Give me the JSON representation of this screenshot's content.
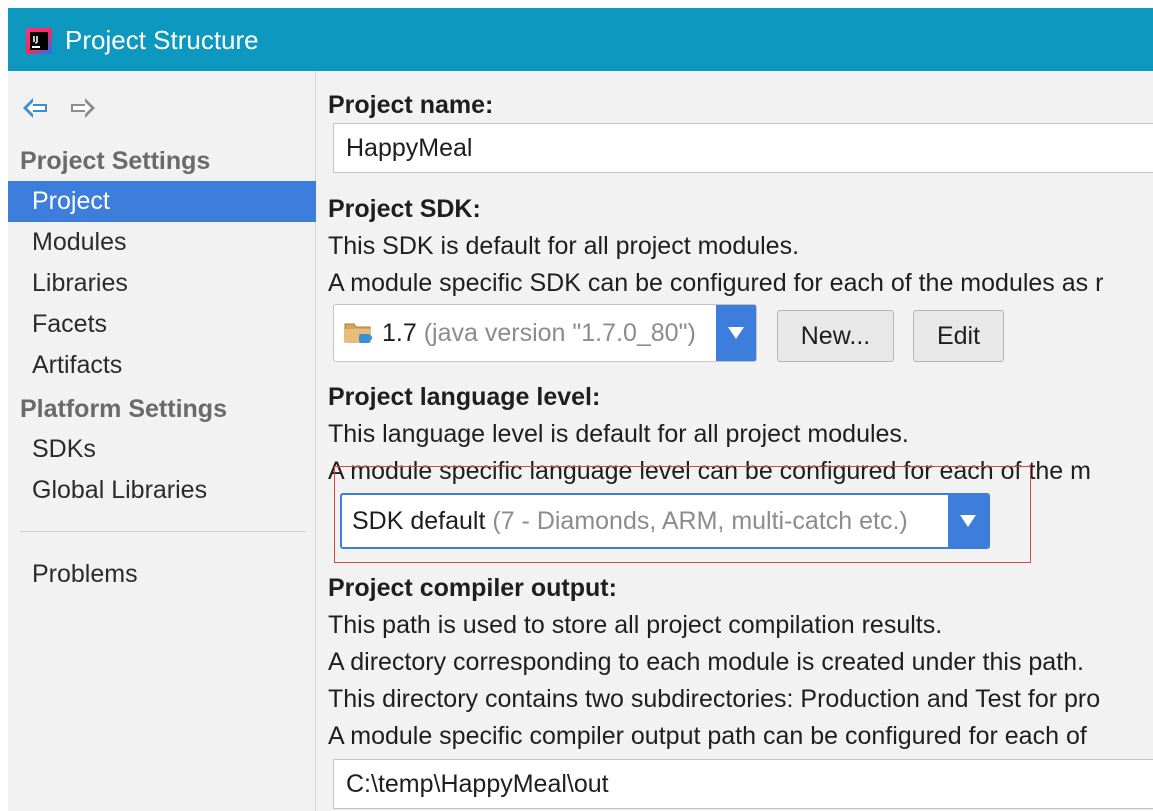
{
  "window": {
    "title": "Project Structure",
    "icon": "intellij-icon",
    "colors": {
      "titlebar": "#0d99bf",
      "accent": "#3d7ddb",
      "highlight": "#d94545"
    }
  },
  "sidebar": {
    "nav_icons": [
      "back-arrow-icon",
      "forward-arrow-icon"
    ],
    "project_settings_header": "Project Settings",
    "project_settings_items": [
      {
        "label": "Project",
        "selected": true
      },
      {
        "label": "Modules"
      },
      {
        "label": "Libraries"
      },
      {
        "label": "Facets"
      },
      {
        "label": "Artifacts"
      }
    ],
    "platform_settings_header": "Platform Settings",
    "platform_settings_items": [
      {
        "label": "SDKs"
      },
      {
        "label": "Global Libraries"
      }
    ],
    "problems_label": "Problems"
  },
  "main": {
    "project_name": {
      "label": "Project name:",
      "value": "HappyMeal"
    },
    "project_sdk": {
      "label": "Project SDK:",
      "desc1": "This SDK is default for all project modules.",
      "desc2": "A module specific SDK can be configured for each of the modules as r",
      "selected_version": "1.7",
      "selected_detail": "(java version \"1.7.0_80\")",
      "icon": "folder-java-icon",
      "new_button": "New...",
      "edit_button": "Edit"
    },
    "language_level": {
      "label": "Project language level:",
      "desc1": "This language level is default for all project modules.",
      "desc2": "A module specific language level can be configured for each of the m",
      "selected_value": "SDK default",
      "selected_detail": "(7 - Diamonds, ARM, multi-catch etc.)"
    },
    "compiler_output": {
      "label": "Project compiler output:",
      "desc1": "This path is used to store all project compilation results.",
      "desc2": "A directory corresponding to each module is created under this path.",
      "desc3": "This directory contains two subdirectories: Production and Test for pro",
      "desc4": "A module specific compiler output path can be configured for each of",
      "value": "C:\\temp\\HappyMeal\\out"
    }
  }
}
